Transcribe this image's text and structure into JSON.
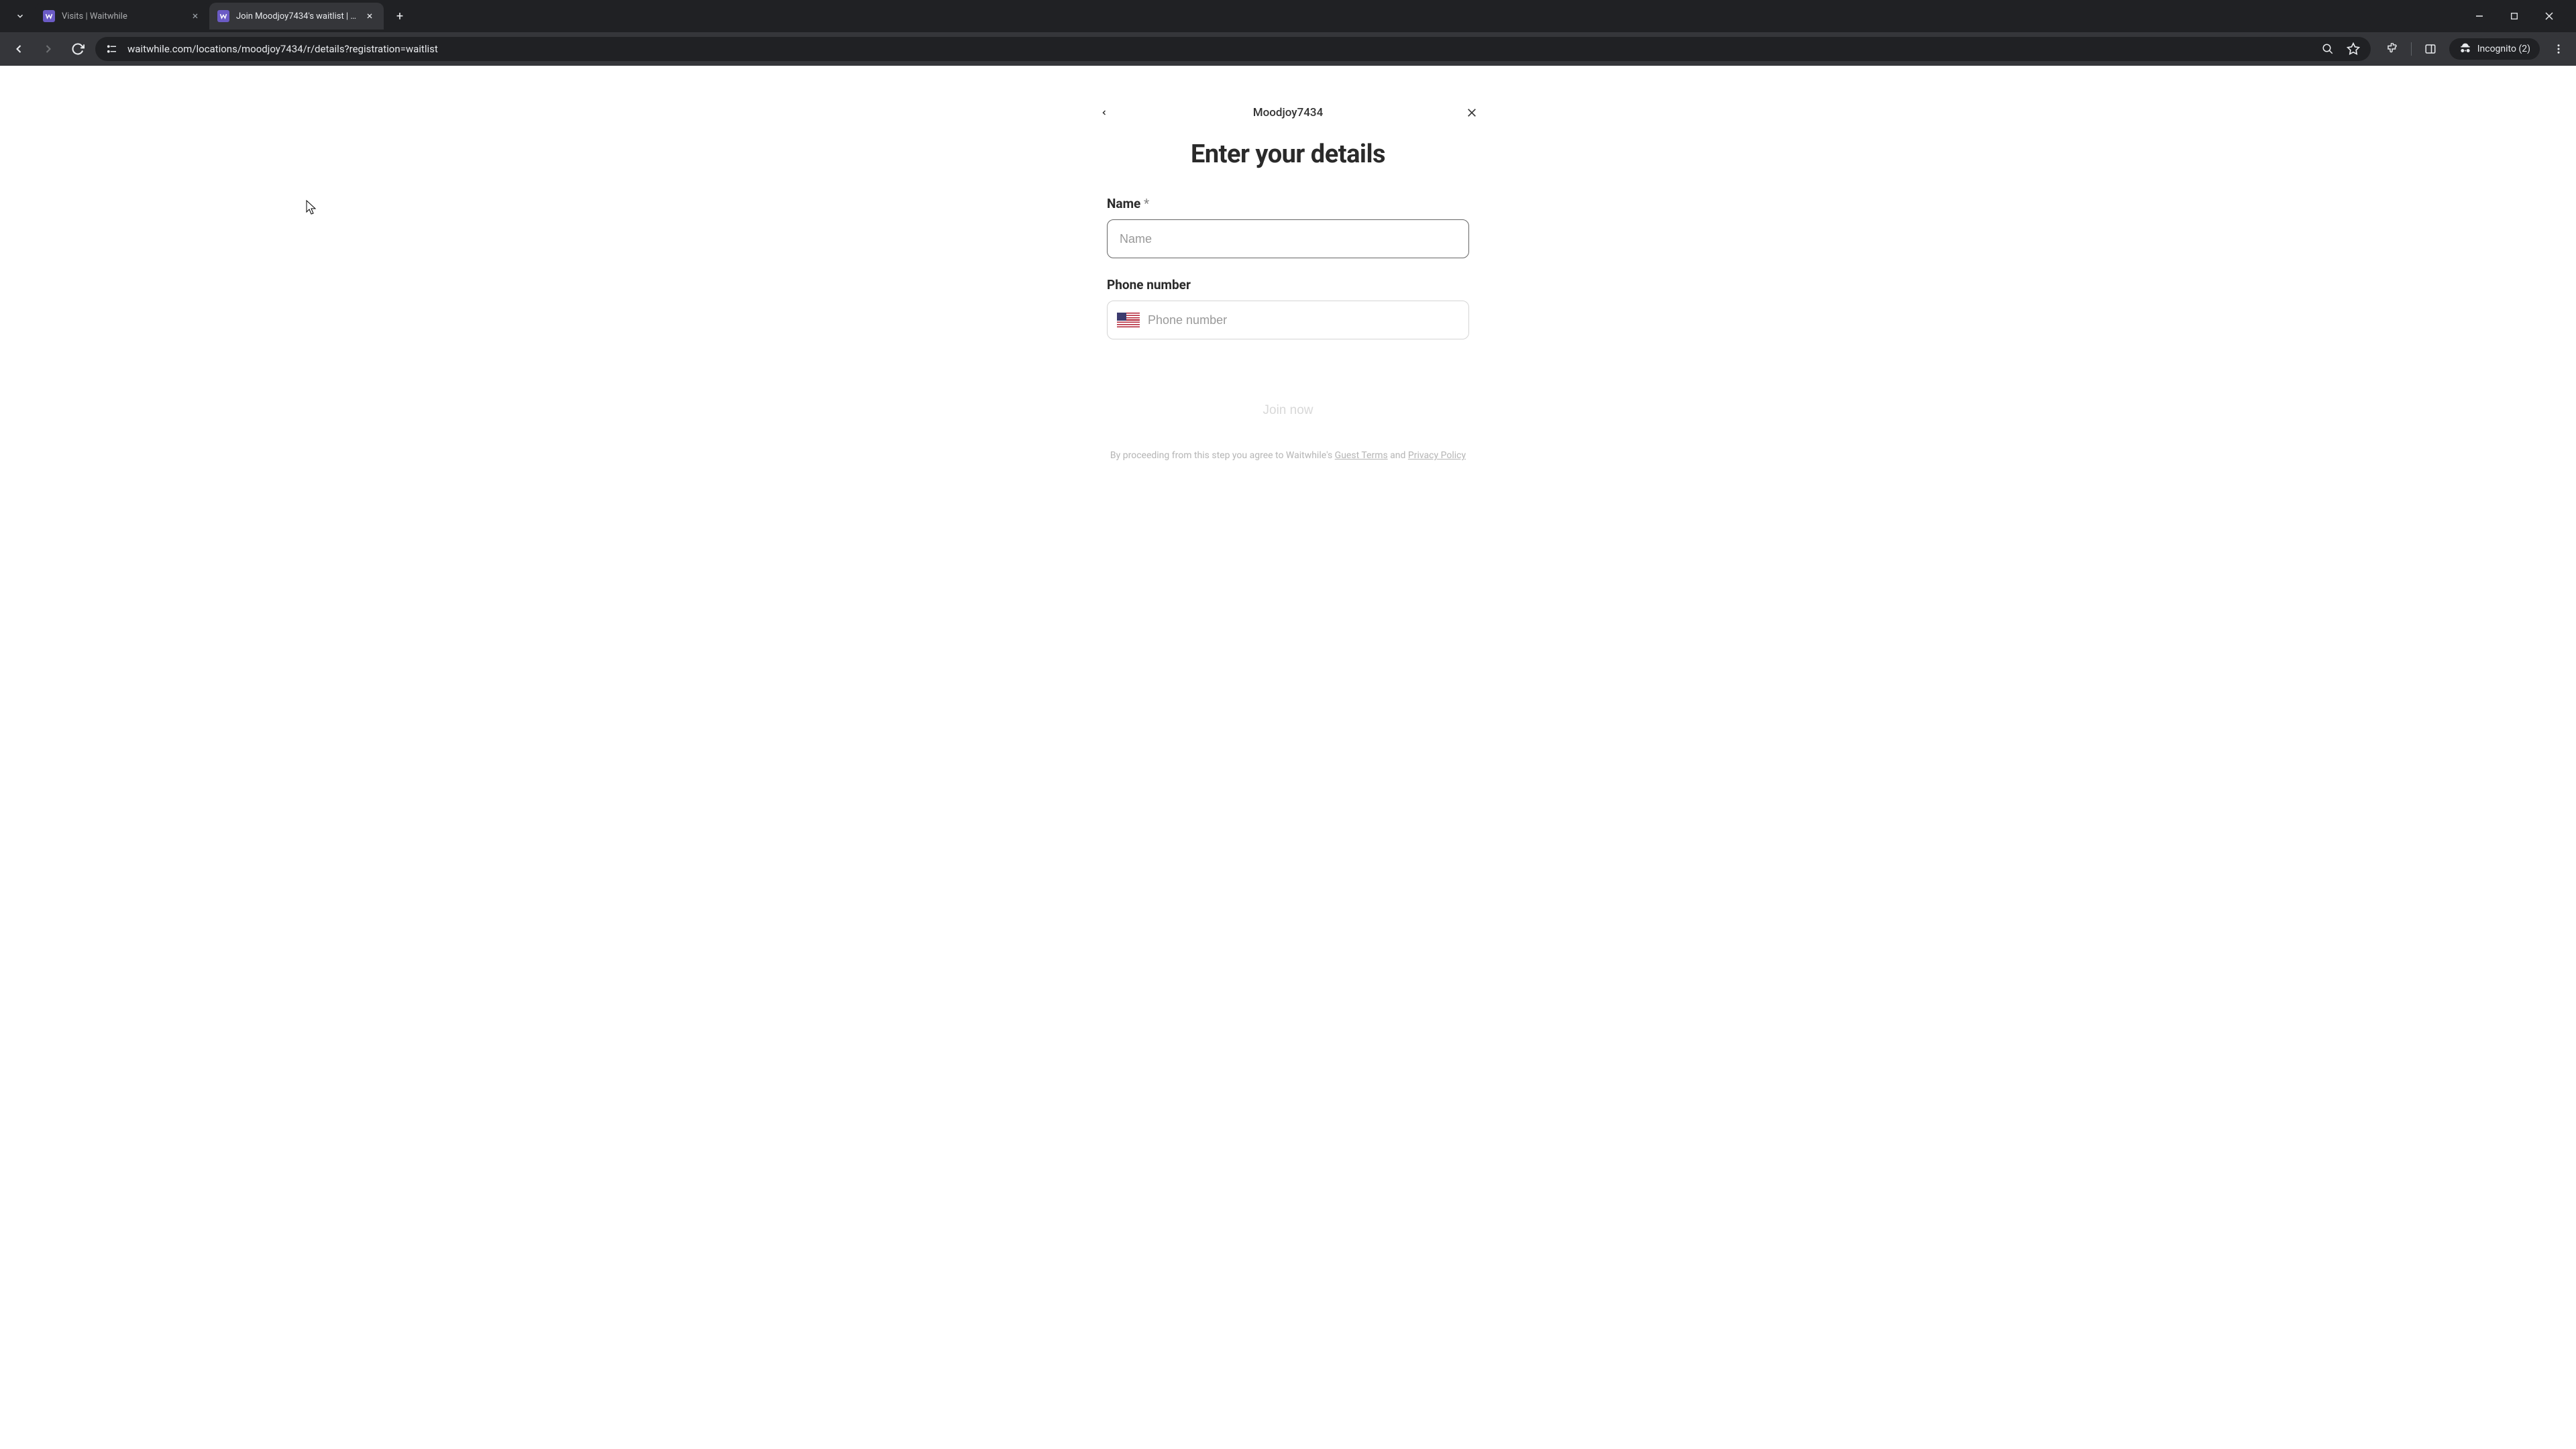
{
  "browser": {
    "tabs": [
      {
        "title": "Visits | Waitwhile",
        "active": false
      },
      {
        "title": "Join Moodjoy7434's waitlist | W",
        "active": true
      }
    ],
    "url": "waitwhile.com/locations/moodjoy7434/r/details?registration=waitlist",
    "incognito_label": "Incognito (2)"
  },
  "form": {
    "location_name": "Moodjoy7434",
    "heading": "Enter your details",
    "name": {
      "label": "Name",
      "required_marker": "*",
      "placeholder": "Name",
      "value": ""
    },
    "phone": {
      "label": "Phone number",
      "placeholder": "Phone number",
      "value": "",
      "country_flag": "us"
    },
    "submit_label": "Join now",
    "legal": {
      "prefix": "By proceeding from this step you agree to Waitwhile's ",
      "terms_label": "Guest Terms",
      "conjunction": " and ",
      "privacy_label": "Privacy Policy"
    }
  }
}
